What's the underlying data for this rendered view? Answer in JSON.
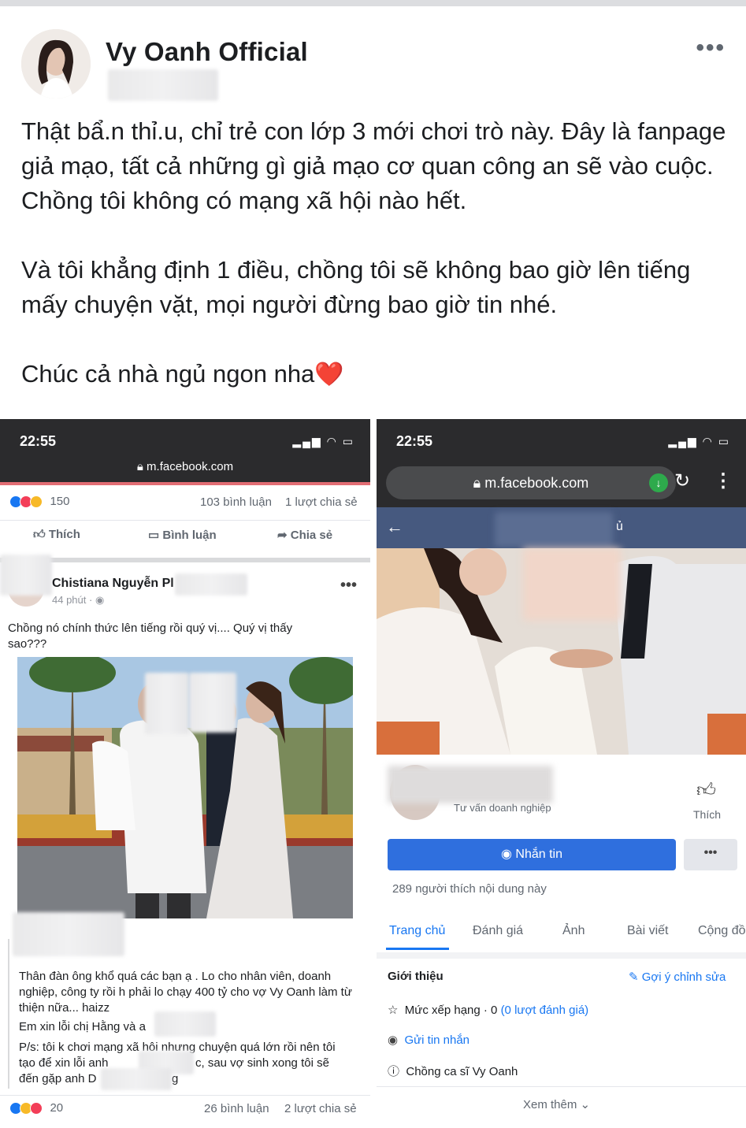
{
  "post": {
    "author": "Vy Oanh Official",
    "paragraphs": [
      "Thật bẩ.n thỉ.u, chỉ trẻ con lớp 3 mới chơi trò này. Đây là fanpage giả mạo, tất cả những gì giả mạo cơ quan công an sẽ vào cuộc. Chồng tôi không có mạng xã hội nào hết.",
      "Và tôi khẳng định 1 điều, chồng tôi sẽ không bao giờ lên tiếng mấy chuyện vặt, mọi người đừng bao giờ tin nhé.",
      "Chúc cả nhà ngủ ngon nha"
    ],
    "heart": "❤️",
    "more": "•••"
  },
  "left_shot": {
    "time": "22:55",
    "url": "m.facebook.com",
    "reactions_count": "150",
    "comments": "103 bình luận",
    "shares": "1 lượt chia sẻ",
    "like": "Thích",
    "comment": "Bình luận",
    "share": "Chia sẻ",
    "poster": "Chistiana Nguyễn Pl",
    "time_ago": "44 phút · ",
    "caption": "Chồng nó chính thức lên tiếng rồi quý vị.... Quý vị thấy sao???",
    "text1": "Thân đàn ông khổ quá các bạn ạ . Lo cho nhân viên, doanh nghiệp, công ty rồi h phải lo chạy 400 tỷ cho vợ Vy Oanh làm từ thiện nữa... haizz",
    "text2": "Em xin lỗi chị Hằng và a",
    "text3": "P/s: tôi k chơi mạng xã hôi nhưng chuyện quá lớn rồi nên tôi tạo để xin lỗi anh",
    "text3b": "c, sau vợ sinh xong tôi sẽ",
    "text4": "đến gặp anh D",
    "text4b": "g",
    "bottom_reactions": "20",
    "bottom_comments": "26 bình luận",
    "bottom_shares": "2 lượt chia sẻ"
  },
  "right_shot": {
    "time": "22:55",
    "url": "m.facebook.com",
    "header_fragment": "ủ",
    "category": "Tư vấn doanh nghiệp",
    "like": "Thích",
    "message": "Nhắn tin",
    "likes_text": "289 người thích nội dung này",
    "tabs": [
      "Trang chủ",
      "Đánh giá",
      "Ảnh",
      "Bài viết",
      "Cộng đồ"
    ],
    "intro_title": "Giới thiệu",
    "suggest_edit": "Gợi ý chỉnh sửa",
    "rating_label": "Mức xếp hạng · 0 ",
    "rating_link": "(0 lượt đánh giá)",
    "send_message": "Gửi tin nhắn",
    "description": "Chồng ca sĩ Vy Oanh",
    "see_more": "Xem thêm"
  },
  "colors": {
    "facebook_blue": "#1877f2",
    "button_blue": "#2f6fde",
    "header_blue": "#46597f",
    "heart_red": "#e0242b"
  }
}
